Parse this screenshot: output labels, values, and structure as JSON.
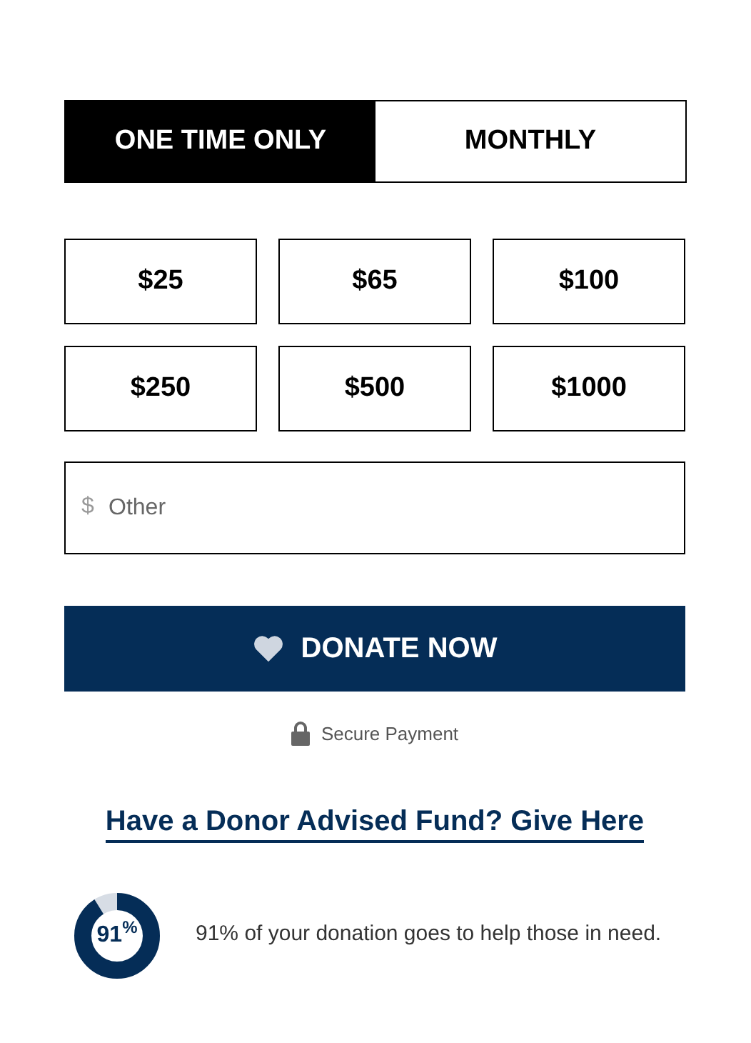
{
  "frequency_tabs": [
    {
      "label": "ONE TIME ONLY",
      "selected": true
    },
    {
      "label": "MONTHLY",
      "selected": false
    }
  ],
  "amounts": [
    {
      "label": "$25",
      "selected": false
    },
    {
      "label": "$65",
      "selected": false
    },
    {
      "label": "$100",
      "selected": false
    },
    {
      "label": "$250",
      "selected": false
    },
    {
      "label": "$500",
      "selected": false
    },
    {
      "label": "$1000",
      "selected": false
    }
  ],
  "other_amount": {
    "prefix": "$",
    "placeholder": "Other"
  },
  "donate_button": {
    "label": "DONATE NOW"
  },
  "secure_note": "Secure Payment",
  "daf_link": "Have a Donor Advised Fund? Give Here",
  "impact": {
    "donut_label": "91$^{%}$",
    "level": 0.91,
    "text": "91% of your donation goes to help those in need."
  }
}
